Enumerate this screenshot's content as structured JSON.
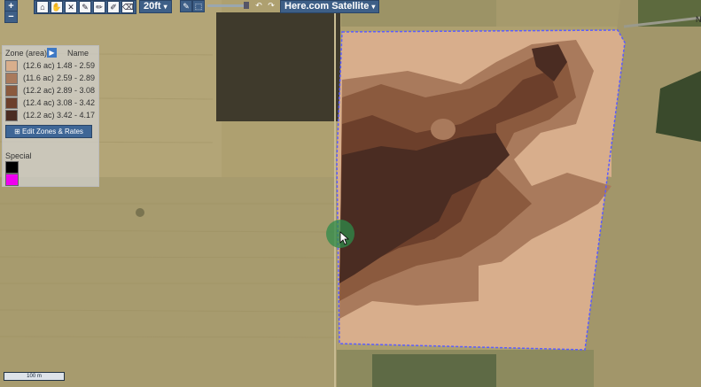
{
  "zoom": {
    "in_label": "+",
    "out_label": "−"
  },
  "toolbar": {
    "tools": [
      {
        "name": "home-tool",
        "glyph": "⌂"
      },
      {
        "name": "pan-tool",
        "glyph": "✋"
      },
      {
        "name": "close-tool",
        "glyph": "✕"
      },
      {
        "name": "pen-tool",
        "glyph": "✎"
      },
      {
        "name": "draw-tool",
        "glyph": "✏"
      },
      {
        "name": "edit-tool",
        "glyph": "✐"
      },
      {
        "name": "eraser-tool",
        "glyph": "⌫"
      }
    ],
    "resolution": "20ft",
    "basemap": "Here.com Satellite"
  },
  "legend": {
    "zone_header": "Zone (area)",
    "name_header": "Name",
    "zones": [
      {
        "area": "(12.6 ac)",
        "range": "1.48 - 2.59",
        "color": "#d8ae8c"
      },
      {
        "area": "(11.6 ac)",
        "range": "2.59 - 2.89",
        "color": "#a97a5c"
      },
      {
        "area": "(12.2 ac)",
        "range": "2.89 - 3.08",
        "color": "#8b5a3e"
      },
      {
        "area": "(12.4 ac)",
        "range": "3.08 - 3.42",
        "color": "#6c3f2b"
      },
      {
        "area": "(12.2 ac)",
        "range": "3.42 - 4.17",
        "color": "#4a2c22"
      }
    ],
    "edit_button": "Edit Zones & Rates",
    "special_label": "Special",
    "special_colors": [
      "#000000",
      "#f000f0"
    ]
  },
  "scale_label": "100 m",
  "edge_label": "N"
}
